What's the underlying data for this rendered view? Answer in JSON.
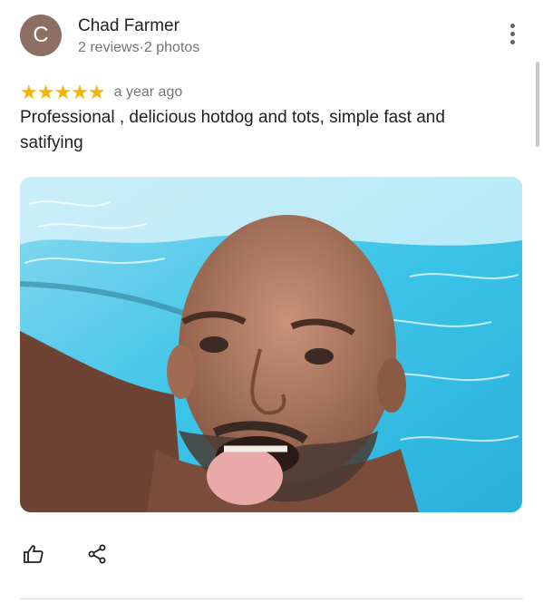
{
  "reviewer": {
    "avatar_initial": "C",
    "avatar_color": "#8d6e63",
    "name": "Chad Farmer",
    "stats": "2 reviews·2 photos"
  },
  "review": {
    "stars": "★★★★★",
    "rating": 5,
    "time": "a year ago",
    "text": "Professional , delicious hotdog and tots, simple fast and satifying"
  },
  "photo": {
    "icon": "review-photo"
  },
  "actions": {
    "like_icon": "thumbs-up-icon",
    "share_icon": "share-icon"
  },
  "colors": {
    "star": "#f5b400",
    "text": "#202124",
    "secondary_text": "#70757a"
  }
}
